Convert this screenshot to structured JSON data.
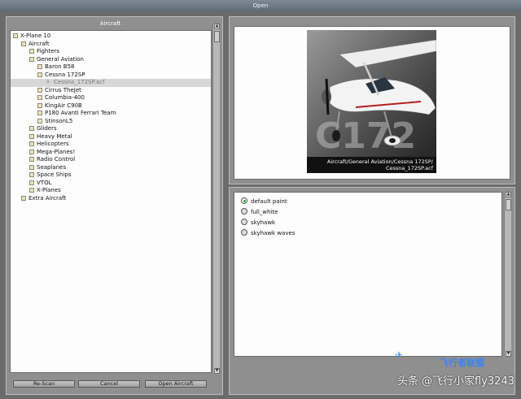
{
  "window": {
    "title": "Open"
  },
  "left_panel": {
    "header": "Aircraft",
    "tree": [
      {
        "label": "X-Plane 10",
        "level": 0,
        "icon": "folder-icon",
        "selected": false
      },
      {
        "label": "Aircraft",
        "level": 1,
        "icon": "folder-icon",
        "selected": false
      },
      {
        "label": "Fighters",
        "level": 2,
        "icon": "folder-icon",
        "selected": false
      },
      {
        "label": "General Aviation",
        "level": 2,
        "icon": "folder-icon",
        "selected": false
      },
      {
        "label": "Baron B58",
        "level": 3,
        "icon": "folder-icon",
        "selected": false
      },
      {
        "label": "Cessna 172SP",
        "level": 3,
        "icon": "folder-icon",
        "selected": false
      },
      {
        "label": "Cessna_172SP.acf",
        "level": 4,
        "icon": "plane-icon",
        "selected": true
      },
      {
        "label": "Cirrus TheJet",
        "level": 3,
        "icon": "folder-icon",
        "selected": false
      },
      {
        "label": "Columbia-400",
        "level": 3,
        "icon": "folder-icon",
        "selected": false
      },
      {
        "label": "KingAir C90B",
        "level": 3,
        "icon": "folder-icon",
        "selected": false
      },
      {
        "label": "P180 Avanti Ferrari Team",
        "level": 3,
        "icon": "folder-icon",
        "selected": false
      },
      {
        "label": "StinsonL5",
        "level": 3,
        "icon": "folder-icon",
        "selected": false
      },
      {
        "label": "Gliders",
        "level": 2,
        "icon": "folder-icon",
        "selected": false
      },
      {
        "label": "Heavy Metal",
        "level": 2,
        "icon": "folder-icon",
        "selected": false
      },
      {
        "label": "Helicopters",
        "level": 2,
        "icon": "folder-icon",
        "selected": false
      },
      {
        "label": "Mega-Planes!",
        "level": 2,
        "icon": "folder-icon",
        "selected": false
      },
      {
        "label": "Radio Control",
        "level": 2,
        "icon": "folder-icon",
        "selected": false
      },
      {
        "label": "Seaplanes",
        "level": 2,
        "icon": "folder-icon",
        "selected": false
      },
      {
        "label": "Space Ships",
        "level": 2,
        "icon": "folder-icon",
        "selected": false
      },
      {
        "label": "VTOL",
        "level": 2,
        "icon": "folder-icon",
        "selected": false
      },
      {
        "label": "X-Planes",
        "level": 2,
        "icon": "folder-icon",
        "selected": false
      },
      {
        "label": "Extra Aircraft",
        "level": 1,
        "icon": "folder-icon",
        "selected": false
      }
    ],
    "buttons": {
      "rescan": "Re-Scan",
      "cancel": "Cancel",
      "open": "Open Aircraft"
    }
  },
  "preview": {
    "image_text": "C172",
    "caption_line1": "Aircraft/General Aviation/Cessna 172SP/",
    "caption_line2": "Cessna_172SP.acf"
  },
  "liveries": [
    {
      "label": "default paint",
      "selected": true
    },
    {
      "label": "full_white",
      "selected": false
    },
    {
      "label": "skyhawk",
      "selected": false
    },
    {
      "label": "skyhawk waves",
      "selected": false
    }
  ],
  "watermark": {
    "brand": "飞行者联盟",
    "text": "头条 @飞行小家fly3243"
  },
  "colors": {
    "titlebar": "#5f6b76",
    "panel_bg": "#8f8f8f",
    "selected_row": "#d7d7d7",
    "radio_on": "#2aa12a"
  }
}
